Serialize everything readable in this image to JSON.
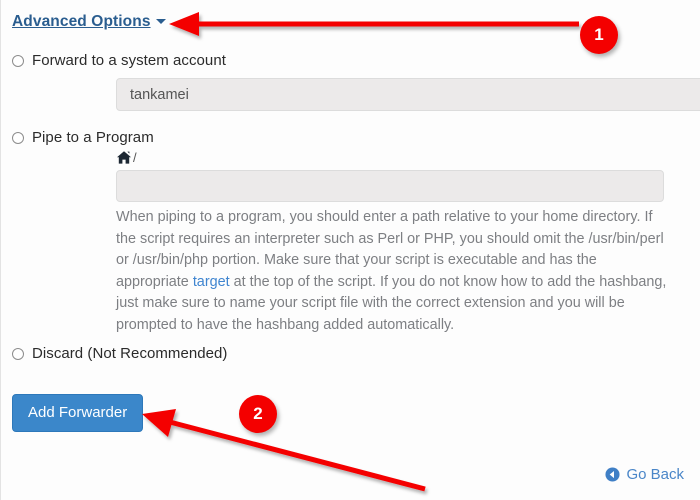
{
  "page": {
    "advanced_options_label": "Advanced Options",
    "caret_icon": "chevron-down-icon"
  },
  "options": [
    {
      "id": "forward-system-account",
      "label": "Forward to a system account",
      "checked": false
    },
    {
      "id": "pipe-to-program",
      "label": "Pipe to a Program",
      "checked": false
    },
    {
      "id": "discard",
      "label": "Discard (Not Recommended)",
      "checked": false
    }
  ],
  "system_account": {
    "value": "tankamei",
    "placeholder": ""
  },
  "pipe_program": {
    "home_icon": "home-icon",
    "path_prefix": "/",
    "value": "",
    "placeholder": ""
  },
  "help": {
    "part1": "When piping to a program, you should enter a path relative to your home directory. If the script requires an interpreter such as Perl or PHP, you should omit the /usr/bin/perl or /usr/bin/php portion. Make sure that your script is executable and has the appropriate ",
    "link": "target",
    "part2": " at the top of the script. If you do not know how to add the hashbang, just make sure to name your script file with the correct extension and you will be prompted to have the hashbang added automatically."
  },
  "buttons": {
    "add_forwarder": "Add Forwarder",
    "go_back": "Go Back",
    "go_back_icon": "arrow-left-circle-icon"
  },
  "annotations": {
    "badges": [
      {
        "number": "1"
      },
      {
        "number": "2"
      }
    ],
    "arrow_color": "#f40000"
  },
  "colors": {
    "link": "#2a5d8f",
    "primary_button": "#3b87ca",
    "help_text": "#7d7f83",
    "inline_link": "#3f85d0",
    "badge": "#f40000"
  }
}
